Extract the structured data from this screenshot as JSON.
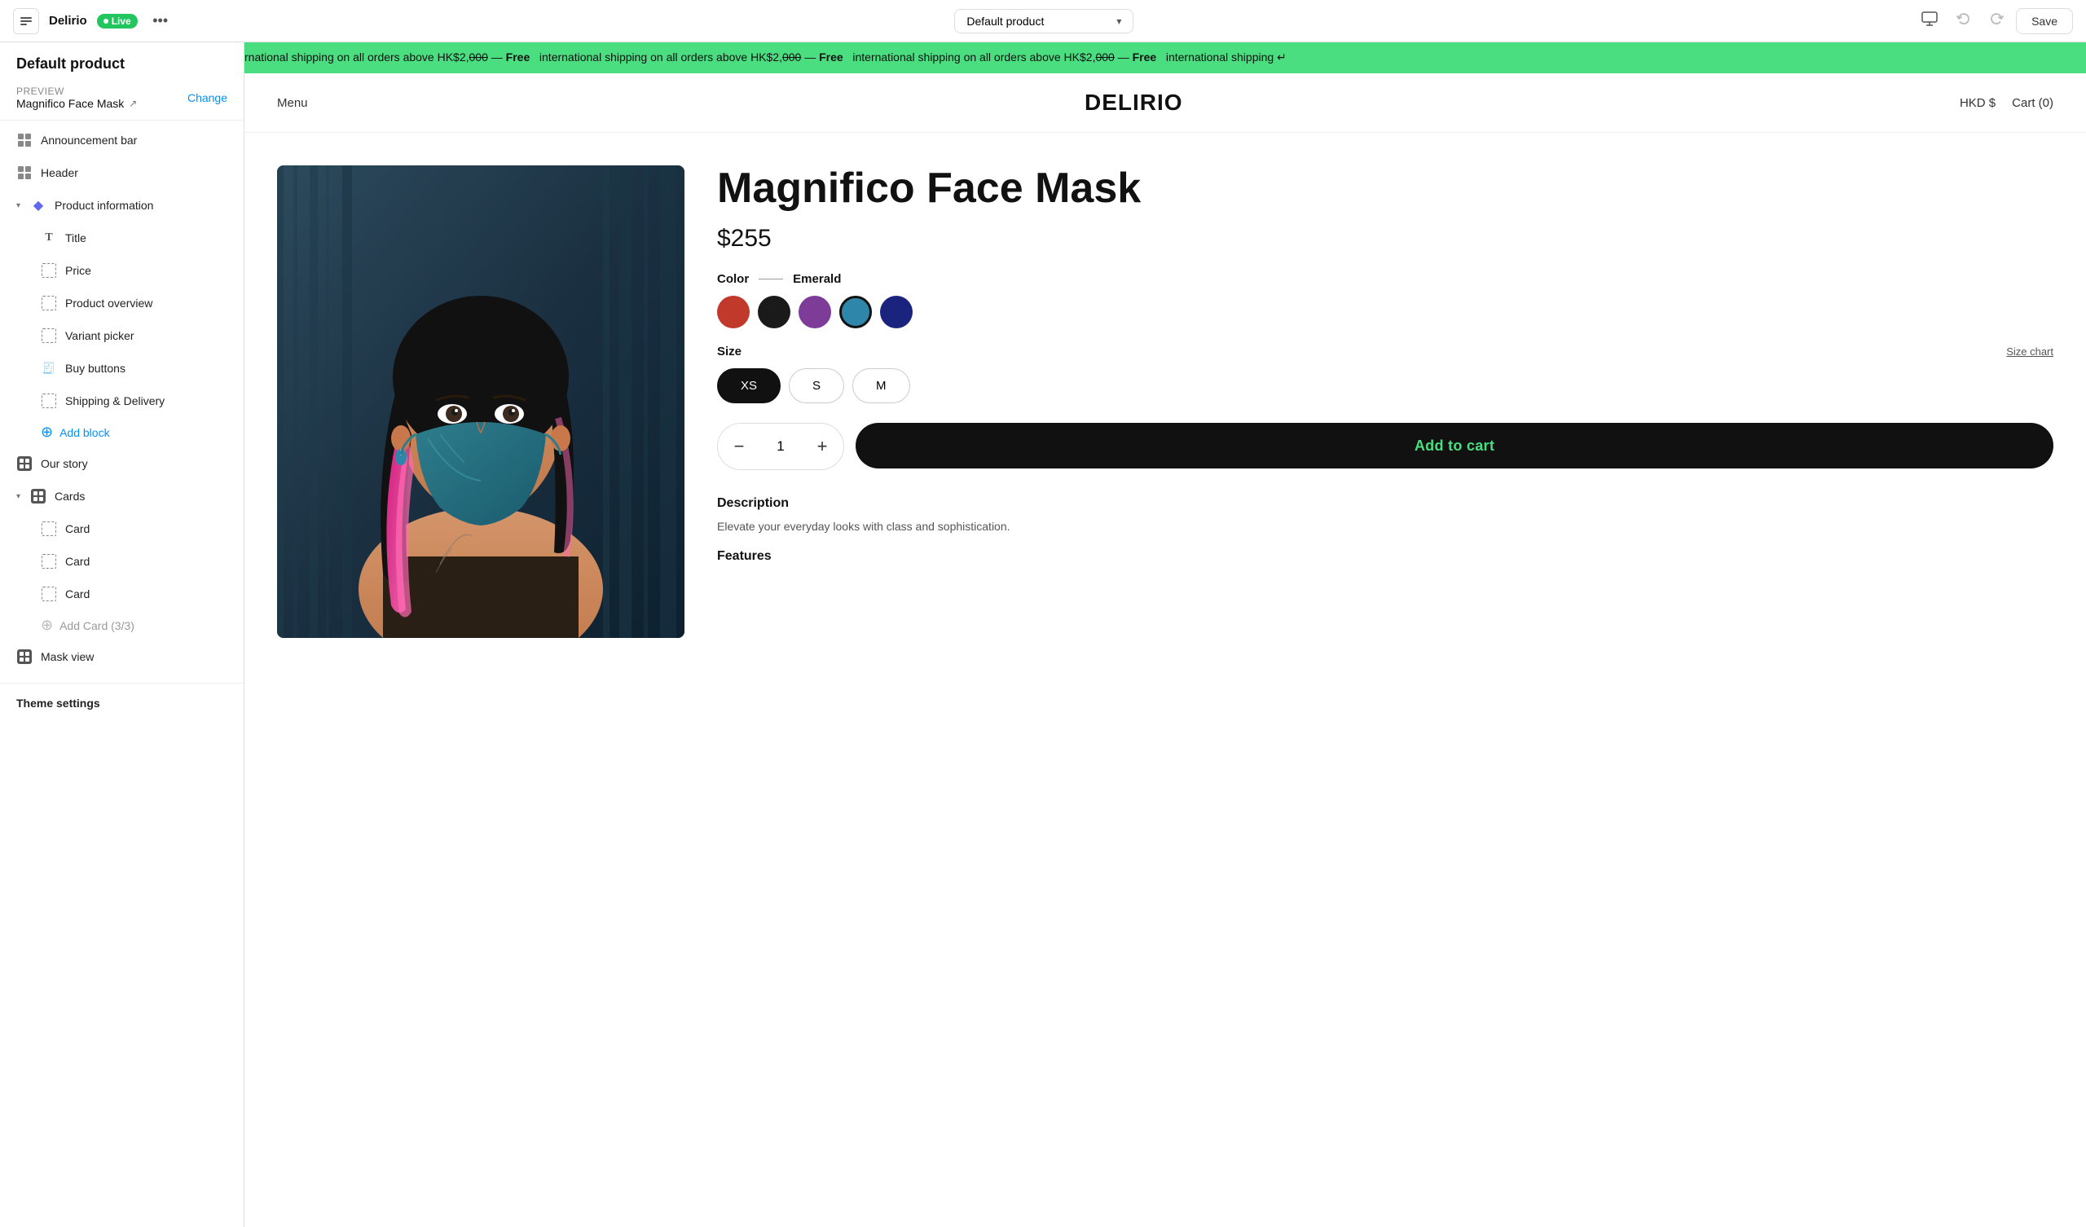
{
  "topbar": {
    "back_label": "←",
    "site_name": "Delirio",
    "live_label": "Live",
    "more_label": "•••",
    "dropdown_value": "Default product",
    "monitor_icon": "🖥",
    "undo_icon": "↺",
    "redo_icon": "↻",
    "save_label": "Save"
  },
  "sidebar": {
    "title": "Default product",
    "preview_label": "PREVIEW",
    "preview_product": "Magnifico Face Mask",
    "change_label": "Change",
    "items": [
      {
        "id": "announcement-bar",
        "label": "Announcement bar",
        "icon_type": "grid",
        "indent": 0
      },
      {
        "id": "header",
        "label": "Header",
        "icon_type": "grid",
        "indent": 0
      },
      {
        "id": "product-information",
        "label": "Product information",
        "icon_type": "diamond",
        "indent": 0,
        "expanded": true
      },
      {
        "id": "title",
        "label": "Title",
        "icon_type": "T",
        "indent": 1
      },
      {
        "id": "price",
        "label": "Price",
        "icon_type": "dashed",
        "indent": 1
      },
      {
        "id": "product-overview",
        "label": "Product overview",
        "icon_type": "dashed",
        "indent": 1
      },
      {
        "id": "variant-picker",
        "label": "Variant picker",
        "icon_type": "dashed",
        "indent": 1
      },
      {
        "id": "buy-buttons",
        "label": "Buy buttons",
        "icon_type": "receipt",
        "indent": 1
      },
      {
        "id": "shipping-delivery",
        "label": "Shipping & Delivery",
        "icon_type": "dashed",
        "indent": 1
      },
      {
        "id": "add-block",
        "label": "Add block",
        "icon_type": "plus-circle",
        "indent": 1,
        "is_add": true
      },
      {
        "id": "our-story",
        "label": "Our story",
        "icon_type": "grid-dark",
        "indent": 0
      },
      {
        "id": "cards",
        "label": "Cards",
        "icon_type": "grid-dark",
        "indent": 0,
        "expanded": true
      },
      {
        "id": "card-1",
        "label": "Card",
        "icon_type": "dashed",
        "indent": 1
      },
      {
        "id": "card-2",
        "label": "Card",
        "icon_type": "dashed",
        "indent": 1
      },
      {
        "id": "card-3",
        "label": "Card",
        "icon_type": "dashed",
        "indent": 1
      },
      {
        "id": "add-card",
        "label": "Add Card (3/3)",
        "icon_type": "plus",
        "indent": 1,
        "is_add_disabled": true
      },
      {
        "id": "mask-view",
        "label": "Mask view",
        "icon_type": "grid-dark",
        "indent": 0
      }
    ],
    "theme_settings_label": "Theme settings"
  },
  "announcement": {
    "text": "rnational shipping on all orders above HK$2,000 — Free  international shipping on all orders above HK$2,000 — Free  international shipping ↵"
  },
  "store": {
    "nav_label": "Menu",
    "logo": "DELIRIO",
    "currency": "HKD $",
    "cart": "Cart (0)"
  },
  "product": {
    "name": "Magnifico Face Mask",
    "price": "$255",
    "color_label": "Color",
    "color_value": "Emerald",
    "colors": [
      {
        "id": "red",
        "value": "#c0392b"
      },
      {
        "id": "black",
        "value": "#1a1a1a"
      },
      {
        "id": "purple",
        "value": "#7d3c98"
      },
      {
        "id": "teal",
        "value": "#2e86ab",
        "selected": true
      },
      {
        "id": "navy",
        "value": "#1a237e"
      }
    ],
    "size_label": "Size",
    "size_chart_label": "Size chart",
    "sizes": [
      {
        "id": "xs",
        "label": "XS",
        "selected": true
      },
      {
        "id": "s",
        "label": "S"
      },
      {
        "id": "m",
        "label": "M"
      }
    ],
    "quantity": 1,
    "add_to_cart_label": "Add to cart",
    "description_title": "Description",
    "description_text": "Elevate your everyday looks with class and sophistication.",
    "features_title": "Features"
  }
}
